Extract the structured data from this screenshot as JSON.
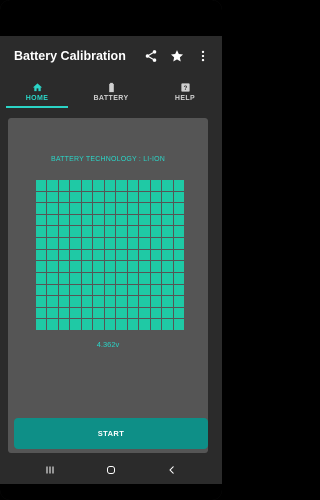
{
  "app": {
    "title": "Battery Calibration",
    "accent_color": "#2bd4c6",
    "button_color": "#0e8f87",
    "cell_color": "#1fc9a5"
  },
  "appbar": {
    "icons": [
      "share-icon",
      "star-icon",
      "more-vert-icon"
    ]
  },
  "tabs": [
    {
      "label": "HOME",
      "icon": "home-icon",
      "active": true
    },
    {
      "label": "BATTERY",
      "icon": "battery-icon",
      "active": false
    },
    {
      "label": "HELP",
      "icon": "help-icon",
      "active": false
    }
  ],
  "main": {
    "technology_text": "BATTERY TECHNOLOGY  :  LI-ION",
    "voltage": "4.362v",
    "grid_rows": 13,
    "grid_cols": 13,
    "start_label": "START"
  },
  "navbar": {
    "icons": [
      "recents-icon",
      "home-circle-icon",
      "back-icon"
    ]
  }
}
